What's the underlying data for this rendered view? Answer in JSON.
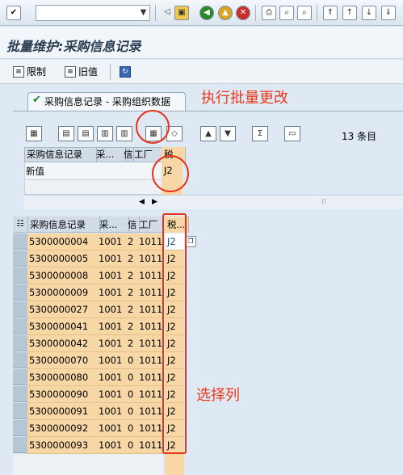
{
  "window": {
    "title": "批量维护:采购信息记录"
  },
  "app_toolbar": {
    "limit_label": "限制",
    "old_value_label": "旧值"
  },
  "tab": {
    "label": "采购信息记录 - 采购组织数据"
  },
  "annotations": {
    "execute": "执行批量更改",
    "select_column": "选择列"
  },
  "record_count": "13 条目",
  "mass_change": {
    "headers": [
      "采购信息记录",
      "采...",
      "信",
      "工厂",
      "税"
    ],
    "new_value_label": "新值",
    "new_value": "J2"
  },
  "grid": {
    "headers": [
      "采购信息记录",
      "采...",
      "信",
      "工厂",
      "税..."
    ],
    "rows": [
      [
        "5300000004",
        "1001",
        "2",
        "1011",
        "J2"
      ],
      [
        "5300000005",
        "1001",
        "2",
        "1011",
        "J2"
      ],
      [
        "5300000008",
        "1001",
        "2",
        "1011",
        "J2"
      ],
      [
        "5300000009",
        "1001",
        "2",
        "1011",
        "J2"
      ],
      [
        "5300000027",
        "1001",
        "2",
        "1011",
        "J2"
      ],
      [
        "5300000041",
        "1001",
        "2",
        "1011",
        "J2"
      ],
      [
        "5300000042",
        "1001",
        "2",
        "1011",
        "J2"
      ],
      [
        "5300000070",
        "1001",
        "0",
        "1011",
        "J2"
      ],
      [
        "5300000080",
        "1001",
        "0",
        "1011",
        "J2"
      ],
      [
        "5300000090",
        "1001",
        "0",
        "1011",
        "J2"
      ],
      [
        "5300000091",
        "1001",
        "0",
        "1011",
        "J2"
      ],
      [
        "5300000092",
        "1001",
        "0",
        "1011",
        "J2"
      ],
      [
        "5300000093",
        "1001",
        "0",
        "1011",
        "J2"
      ]
    ]
  },
  "colors": {
    "annotation": "#e83a1d",
    "selected_row": "#f7d7a5",
    "background": "#dfe9f3"
  }
}
